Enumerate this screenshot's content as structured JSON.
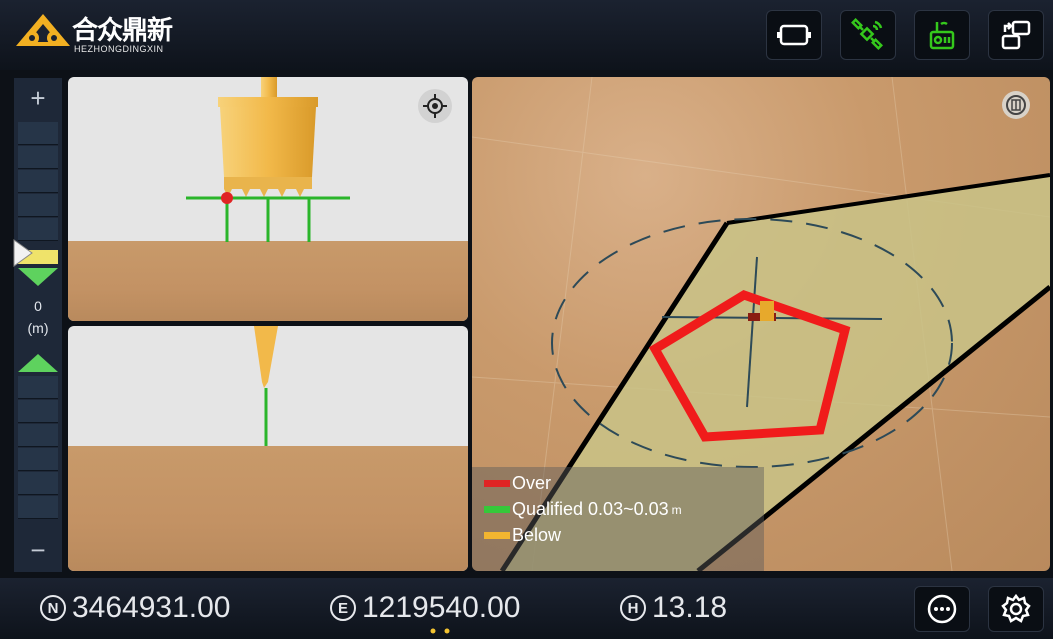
{
  "brand": {
    "name_cn": "合众鼎新",
    "name_en": "HEZHONGDINGXIN"
  },
  "toolbar": {
    "icons": [
      "screen-fit-icon",
      "satellite-icon",
      "radio-icon",
      "switch-view-icon"
    ],
    "active_color": "#35c81c"
  },
  "scale": {
    "plus": "+",
    "minus": "−",
    "value": "0",
    "unit": "(m)"
  },
  "legend": {
    "over": {
      "label": "Over",
      "color": "#e02424"
    },
    "qualified": {
      "label": "Qualified 0.03~0.03",
      "unit": "m",
      "color": "#35c83a"
    },
    "below": {
      "label": "Below",
      "color": "#f2b530"
    }
  },
  "coords": {
    "n_symbol": "N",
    "n_value": "3464931.00",
    "e_symbol": "E",
    "e_value": "1219540.00",
    "h_symbol": "H",
    "h_value": "13.18"
  },
  "bottom_buttons": [
    "more-icon",
    "settings-icon"
  ],
  "pager": {
    "pages": 2,
    "active": 1
  }
}
